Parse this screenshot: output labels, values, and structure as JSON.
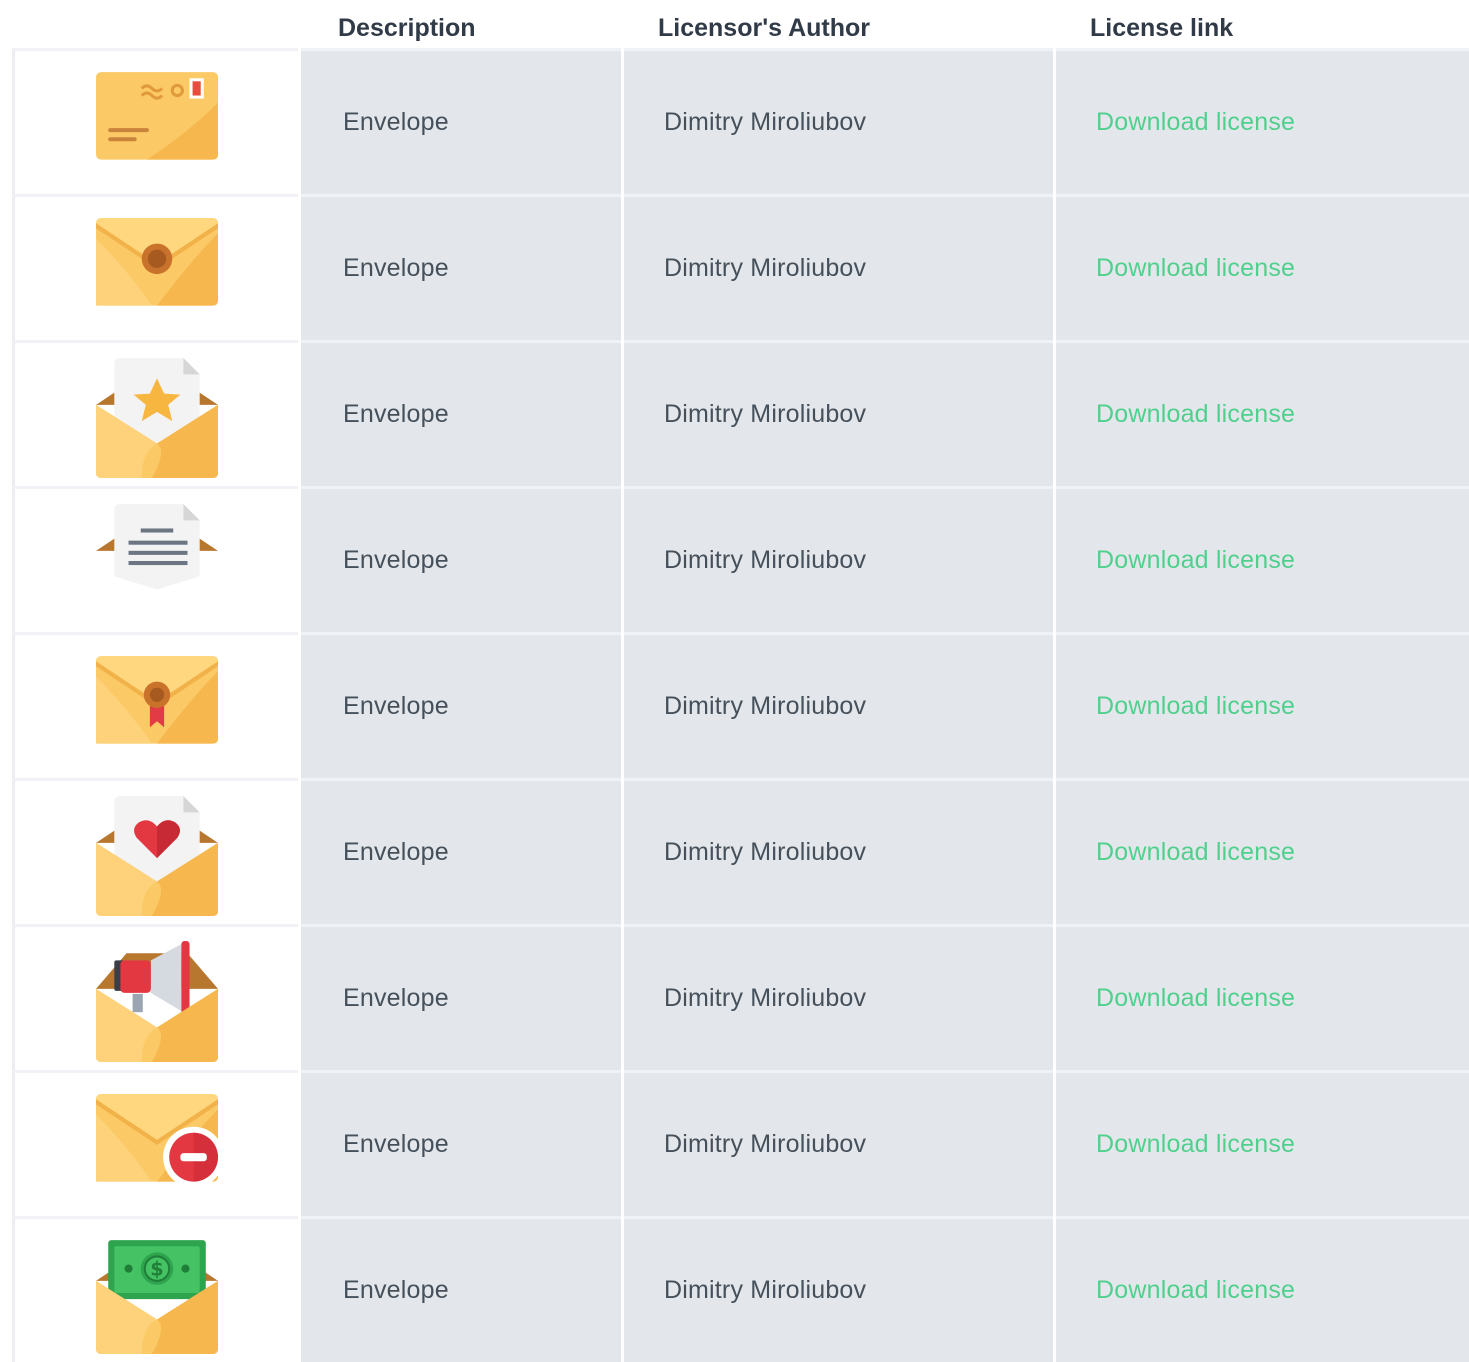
{
  "header": {
    "description": "Description",
    "author": "Licensor's Author",
    "link": "License link"
  },
  "rows": [
    {
      "icon": "envelope-postmark-icon",
      "description": "Envelope",
      "author": "Dimitry Miroliubov",
      "link": "Download license"
    },
    {
      "icon": "envelope-seal-icon",
      "description": "Envelope",
      "author": "Dimitry Miroliubov",
      "link": "Download license"
    },
    {
      "icon": "envelope-star-icon",
      "description": "Envelope",
      "author": "Dimitry Miroliubov",
      "link": "Download license"
    },
    {
      "icon": "envelope-letter-icon",
      "description": "Envelope",
      "author": "Dimitry Miroliubov",
      "link": "Download license"
    },
    {
      "icon": "envelope-wax-ribbon-icon",
      "description": "Envelope",
      "author": "Dimitry Miroliubov",
      "link": "Download license"
    },
    {
      "icon": "envelope-heart-icon",
      "description": "Envelope",
      "author": "Dimitry Miroliubov",
      "link": "Download license"
    },
    {
      "icon": "envelope-megaphone-icon",
      "description": "Envelope",
      "author": "Dimitry Miroliubov",
      "link": "Download license"
    },
    {
      "icon": "envelope-blocked-icon",
      "description": "Envelope",
      "author": "Dimitry Miroliubov",
      "link": "Download license"
    },
    {
      "icon": "envelope-money-icon",
      "description": "Envelope",
      "author": "Dimitry Miroliubov",
      "link": "Download license"
    }
  ],
  "colors": {
    "link": "#4fd08c",
    "cell_bg": "#e3e7eb",
    "text": "#46505b",
    "header_text": "#313b47",
    "envelope": "#fbc965",
    "envelope_dark": "#f6b74e"
  }
}
